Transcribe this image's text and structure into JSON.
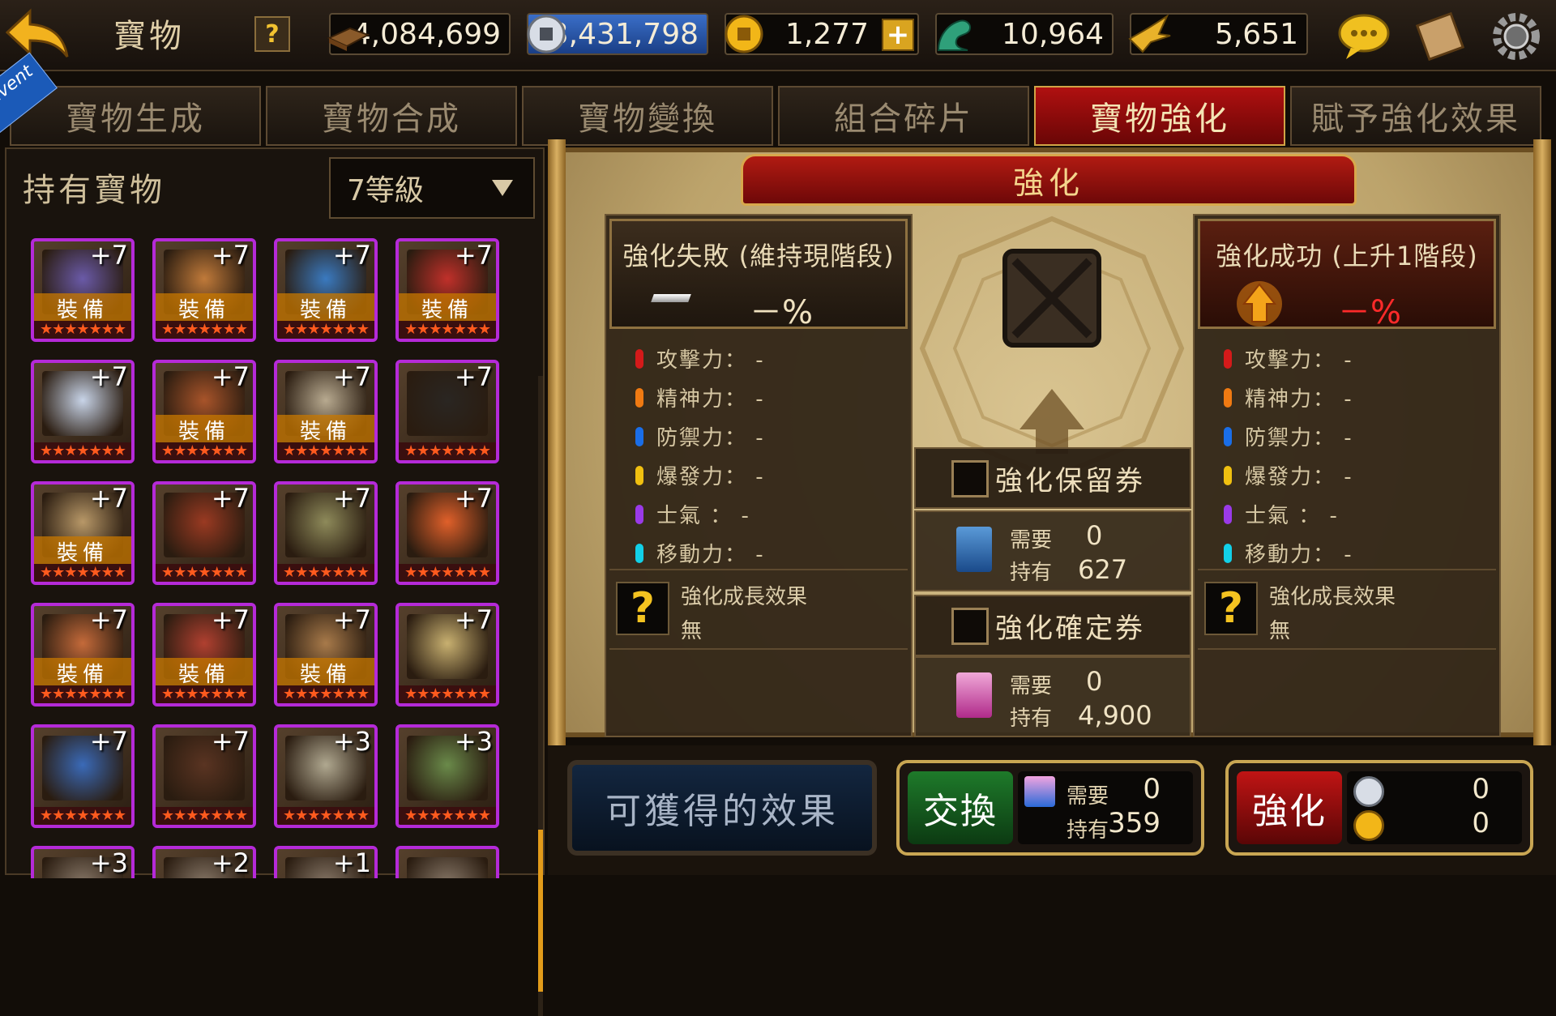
{
  "topbar": {
    "title": "寶物",
    "help_label": "?",
    "resources": [
      {
        "name": "book-icon",
        "value": "4,084,699"
      },
      {
        "name": "silver-coin-icon",
        "value": "3,431,798"
      },
      {
        "name": "gold-coin-icon",
        "value": "1,277",
        "add_label": "+"
      },
      {
        "name": "jade-dragon-icon",
        "value": "10,964"
      },
      {
        "name": "golden-bird-icon",
        "value": "5,651"
      }
    ]
  },
  "event_ribbon": "Event",
  "tabs": [
    {
      "label": "寶物生成",
      "active": false
    },
    {
      "label": "寶物合成",
      "active": false
    },
    {
      "label": "寶物變換",
      "active": false
    },
    {
      "label": "組合碎片",
      "active": false
    },
    {
      "label": "寶物強化",
      "active": true
    },
    {
      "label": "賦予強化效果",
      "active": false
    }
  ],
  "inventory": {
    "title": "持有寶物",
    "grade_selected": "7等級",
    "star_text": "★★★★★★★",
    "equip_label": "裝備",
    "items": [
      {
        "level": "+7",
        "equipped": true,
        "color": "#6a5aa8"
      },
      {
        "level": "+7",
        "equipped": true,
        "color": "#c07a3a"
      },
      {
        "level": "+7",
        "equipped": true,
        "color": "#3a7ac0"
      },
      {
        "level": "+7",
        "equipped": true,
        "color": "#c0302a"
      },
      {
        "level": "+7",
        "equipped": false,
        "color": "#c8d4e8"
      },
      {
        "level": "+7",
        "equipped": true,
        "color": "#a8542a"
      },
      {
        "level": "+7",
        "equipped": true,
        "color": "#b8aa90"
      },
      {
        "level": "+7",
        "equipped": false,
        "color": "#2a2622"
      },
      {
        "level": "+7",
        "equipped": true,
        "color": "#b89868"
      },
      {
        "level": "+7",
        "equipped": false,
        "color": "#9a3a22"
      },
      {
        "level": "+7",
        "equipped": false,
        "color": "#8e8a5a"
      },
      {
        "level": "+7",
        "equipped": false,
        "color": "#e0602a"
      },
      {
        "level": "+7",
        "equipped": true,
        "color": "#c46a3a"
      },
      {
        "level": "+7",
        "equipped": true,
        "color": "#b04030"
      },
      {
        "level": "+7",
        "equipped": true,
        "color": "#a87a4a"
      },
      {
        "level": "+7",
        "equipped": false,
        "color": "#c8b070"
      },
      {
        "level": "+7",
        "equipped": false,
        "color": "#3a6ab8"
      },
      {
        "level": "+7",
        "equipped": false,
        "color": "#5a3422"
      },
      {
        "level": "+3",
        "equipped": false,
        "color": "#b0a890"
      },
      {
        "level": "+3",
        "equipped": false,
        "color": "#6a8a4a"
      },
      {
        "level": "+3",
        "equipped": false,
        "color": "#8a7a6a"
      },
      {
        "level": "+2",
        "equipped": false,
        "color": "#8a7a6a"
      },
      {
        "level": "+1",
        "equipped": false,
        "color": "#8a7a6a"
      },
      {
        "level": "",
        "equipped": false,
        "color": "#8a7a6a"
      }
    ]
  },
  "enhance": {
    "banner": "強化",
    "fail": {
      "title": "強化失敗 (維持現階段)",
      "pct": "－%"
    },
    "success": {
      "title": "強化成功 (上升1階段)",
      "pct": "－%"
    },
    "stats": [
      {
        "label": "攻擊力： -",
        "color": "#d41a1a"
      },
      {
        "label": "精神力： -",
        "color": "#f07a12"
      },
      {
        "label": "防禦力： -",
        "color": "#1a6ee8"
      },
      {
        "label": "爆發力： -",
        "color": "#f0c010"
      },
      {
        "label": "士氣 ： -",
        "color": "#9a3ae8"
      },
      {
        "label": "移動力： -",
        "color": "#12d0e8"
      }
    ],
    "growth_title": "強化成長效果",
    "growth_value": "無",
    "help_q": "?"
  },
  "options": {
    "retain": {
      "label": "強化保留券",
      "need_label": "需要",
      "need": "0",
      "have_label": "持有",
      "have": "627"
    },
    "confirm": {
      "label": "強化確定券",
      "need_label": "需要",
      "need": "0",
      "have_label": "持有",
      "have": "4,900"
    }
  },
  "bottom": {
    "effects_label": "可獲得的效果",
    "exchange": {
      "label": "交換",
      "need_label": "需要",
      "need": "0",
      "have_label": "持有",
      "have": "359"
    },
    "enhance": {
      "label": "強化",
      "silver": "0",
      "gold": "0"
    }
  }
}
